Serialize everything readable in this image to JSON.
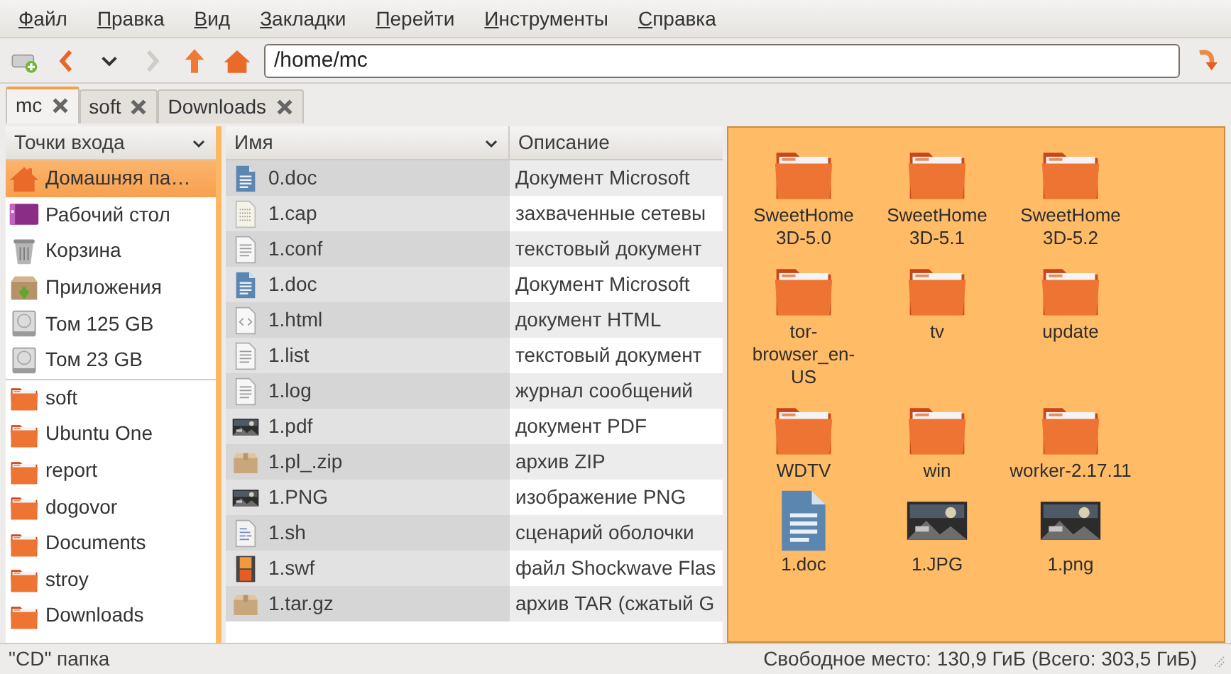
{
  "menu": [
    "Файл",
    "Правка",
    "Вид",
    "Закладки",
    "Перейти",
    "Инструменты",
    "Справка"
  ],
  "toolbar": {
    "address": "/home/mc",
    "forward_disabled": true
  },
  "tabs": [
    {
      "label": "mc",
      "selected": true
    },
    {
      "label": "soft",
      "selected": false
    },
    {
      "label": "Downloads",
      "selected": false
    }
  ],
  "sidebar": {
    "header": "Точки входа",
    "places": [
      {
        "label": "Домашняя па…",
        "kind": "home",
        "selected": true
      },
      {
        "label": "Рабочий стол",
        "kind": "desktop",
        "selected": false
      },
      {
        "label": "Корзина",
        "kind": "trash",
        "selected": false
      },
      {
        "label": "Приложения",
        "kind": "apps",
        "selected": false
      },
      {
        "label": "Том 125 GB",
        "kind": "drive",
        "selected": false
      },
      {
        "label": "Том 23 GB",
        "kind": "drive",
        "selected": false
      }
    ],
    "bookmarks": [
      {
        "label": "soft",
        "selected": false
      },
      {
        "label": "Ubuntu One",
        "selected": false
      },
      {
        "label": "report",
        "selected": false
      },
      {
        "label": "dogovor",
        "selected": false
      },
      {
        "label": "Documents",
        "selected": false
      },
      {
        "label": "stroy",
        "selected": false
      },
      {
        "label": "Downloads",
        "selected": false
      }
    ]
  },
  "file_list": {
    "columns": [
      "Имя",
      "Описание"
    ],
    "rows": [
      {
        "name": "0.doc",
        "description": "Документ Microsoft",
        "kind": "word"
      },
      {
        "name": "1.cap",
        "description": "захваченные сетевы",
        "kind": "data"
      },
      {
        "name": "1.conf",
        "description": "текстовый документ",
        "kind": "text"
      },
      {
        "name": "1.doc",
        "description": "Документ Microsoft",
        "kind": "word"
      },
      {
        "name": "1.html",
        "description": "документ HTML",
        "kind": "html"
      },
      {
        "name": "1.list",
        "description": "текстовый документ",
        "kind": "text"
      },
      {
        "name": "1.log",
        "description": "журнал сообщений",
        "kind": "text"
      },
      {
        "name": "1.pdf",
        "description": "документ PDF",
        "kind": "picture"
      },
      {
        "name": "1.pl_.zip",
        "description": "архив ZIP",
        "kind": "archive"
      },
      {
        "name": "1.PNG",
        "description": "изображение PNG",
        "kind": "picture"
      },
      {
        "name": "1.sh",
        "description": "сценарий оболочки",
        "kind": "script"
      },
      {
        "name": "1.swf",
        "description": "файл Shockwave Flas",
        "kind": "video"
      },
      {
        "name": "1.tar.gz",
        "description": "архив TAR (сжатый G",
        "kind": "archive"
      }
    ]
  },
  "icon_view": [
    {
      "label": "SweetHome 3D-5.0",
      "kind": "folder"
    },
    {
      "label": "SweetHome 3D-5.1",
      "kind": "folder"
    },
    {
      "label": "SweetHome 3D-5.2",
      "kind": "folder"
    },
    {
      "label": "tor-browser_en-US",
      "kind": "folder"
    },
    {
      "label": "tv",
      "kind": "folder"
    },
    {
      "label": "update",
      "kind": "folder"
    },
    {
      "label": "WDTV",
      "kind": "folder"
    },
    {
      "label": "win",
      "kind": "folder"
    },
    {
      "label": "worker-2.17.11",
      "kind": "folder"
    },
    {
      "label": "1.doc",
      "kind": "word"
    },
    {
      "label": "1.JPG",
      "kind": "picture"
    },
    {
      "label": "1.png",
      "kind": "picture"
    }
  ],
  "status_bar": {
    "left": "\"CD\" папка",
    "right": "Свободное место: 130,9 ГиБ (Всего: 303,5 ГиБ)"
  }
}
